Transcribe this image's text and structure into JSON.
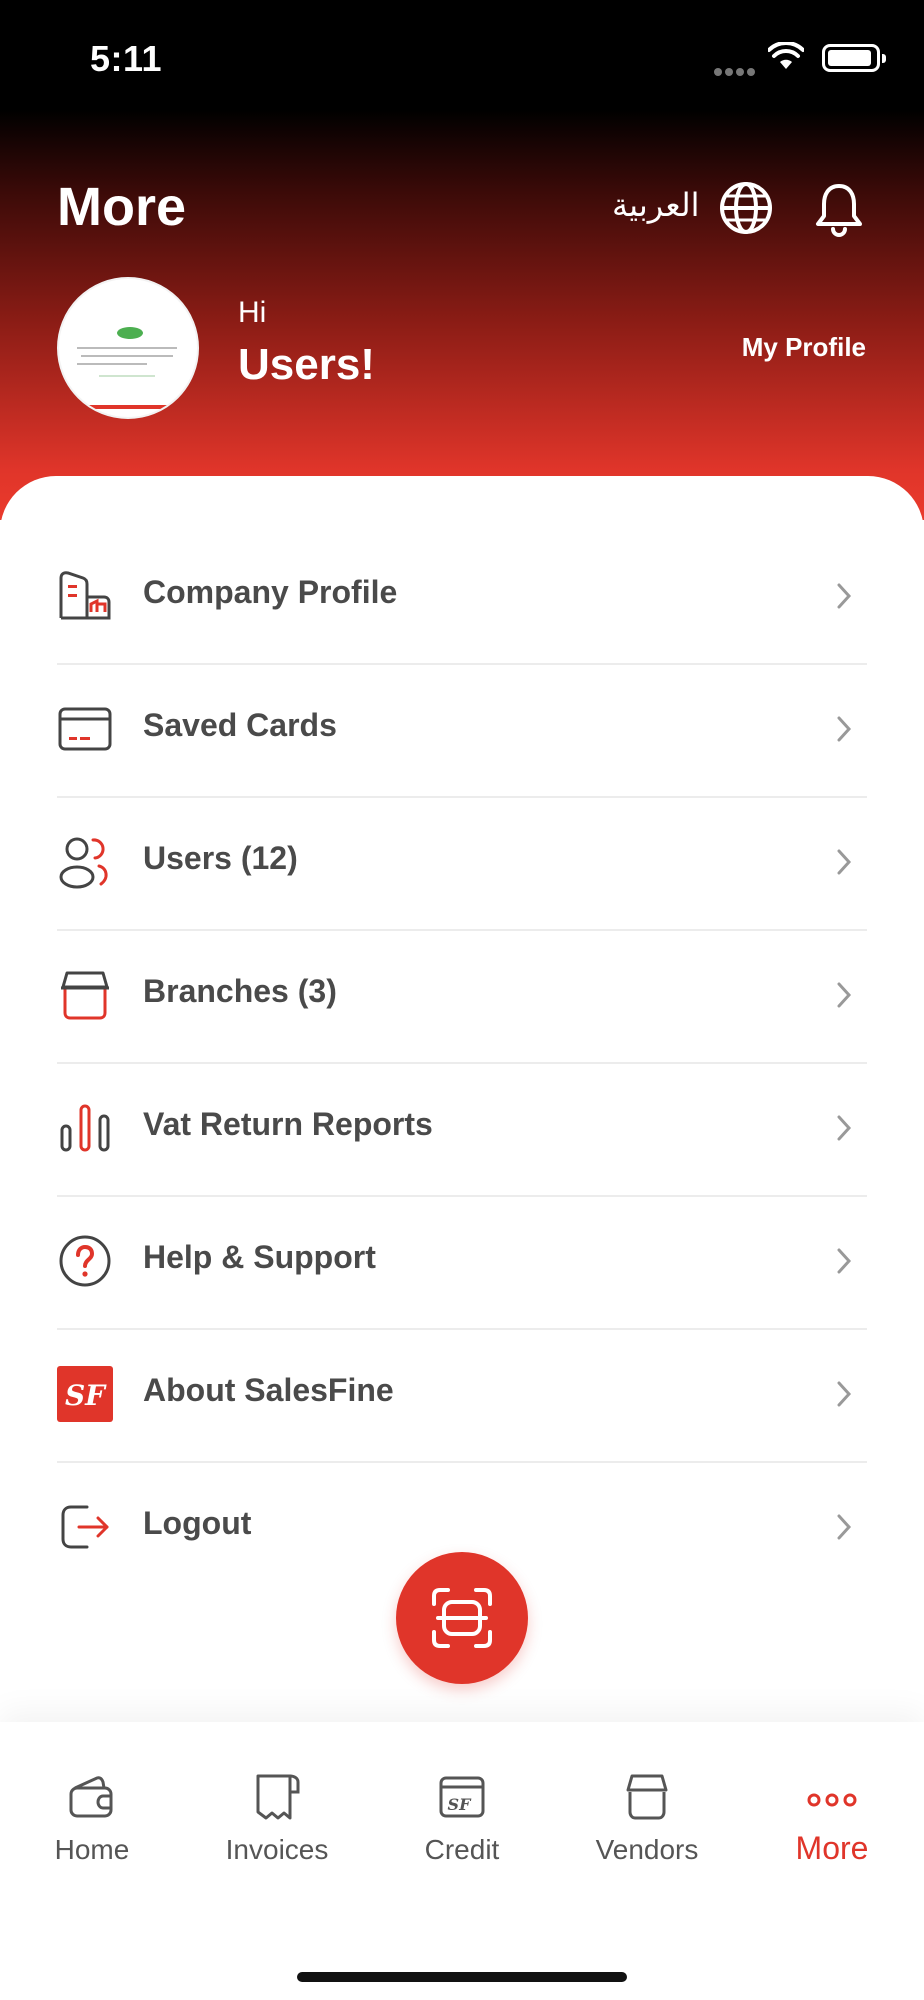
{
  "status_bar": {
    "time": "5:11"
  },
  "header": {
    "title": "More",
    "language_label": "العربية",
    "greeting": "Hi",
    "user_name": "Users!",
    "my_profile_label": "My Profile"
  },
  "menu": {
    "items": [
      {
        "label": "Company Profile",
        "icon": "company-icon"
      },
      {
        "label": "Saved Cards",
        "icon": "card-icon"
      },
      {
        "label": "Users (12)",
        "icon": "users-icon"
      },
      {
        "label": "Branches (3)",
        "icon": "store-icon"
      },
      {
        "label": "Vat Return Reports",
        "icon": "bar-chart-icon"
      },
      {
        "label": "Help & Support",
        "icon": "help-icon"
      },
      {
        "label": "About SalesFine",
        "icon": "salesfine-logo-icon",
        "logo_text": "SF"
      },
      {
        "label": "Logout",
        "icon": "logout-icon"
      }
    ]
  },
  "tabs": [
    {
      "label": "Home",
      "icon": "wallet-icon",
      "active": false
    },
    {
      "label": "Invoices",
      "icon": "receipt-icon",
      "active": false
    },
    {
      "label": "Credit",
      "icon": "credit-icon",
      "active": false
    },
    {
      "label": "Vendors",
      "icon": "vendor-icon",
      "active": false
    },
    {
      "label": "More",
      "icon": "more-dots-icon",
      "active": true
    }
  ],
  "colors": {
    "accent": "#e0352a",
    "text": "#4a4a4a",
    "header_top": "#000000"
  }
}
